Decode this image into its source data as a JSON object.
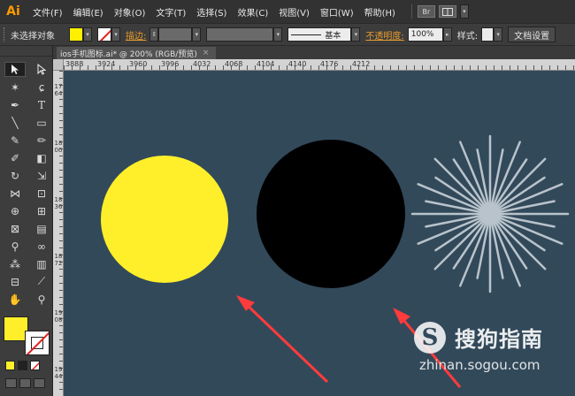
{
  "app": {
    "logo": "Ai"
  },
  "menu": {
    "items": [
      "文件(F)",
      "编辑(E)",
      "对象(O)",
      "文字(T)",
      "选择(S)",
      "效果(C)",
      "视图(V)",
      "窗口(W)",
      "帮助(H)"
    ],
    "bridge_icon": "Br"
  },
  "control_bar": {
    "selection_status": "未选择对象",
    "stroke_label": "描边:",
    "brush_style": "基本",
    "opacity_label": "不透明度:",
    "opacity_value": "100%",
    "style_label": "样式:",
    "doc_settings_button": "文档设置"
  },
  "document": {
    "tab_title": "ios手机图标.ai* @ 200% (RGB/预览)",
    "close_glyph": "×"
  },
  "rulers": {
    "top_labels": [
      "3888",
      "3924",
      "3960",
      "3996",
      "4032",
      "4068",
      "4104",
      "4140",
      "4176",
      "4212"
    ],
    "left_labels": [
      "1764",
      "1800",
      "1836",
      "1872",
      "1908",
      "1944"
    ]
  },
  "canvas": {
    "background": "#32495a",
    "shapes": {
      "yellow_circle_color": "#ffef2a",
      "black_circle_color": "#000000",
      "starburst_color": "#b9c3cb",
      "arrow_color": "#ff3b3b"
    }
  },
  "colors": {
    "fill": "#ffef2a",
    "stroke": "none"
  },
  "watermark": {
    "logo_letter": "S",
    "brand": "搜狗指南",
    "url": "zhinan.sogou.com"
  }
}
